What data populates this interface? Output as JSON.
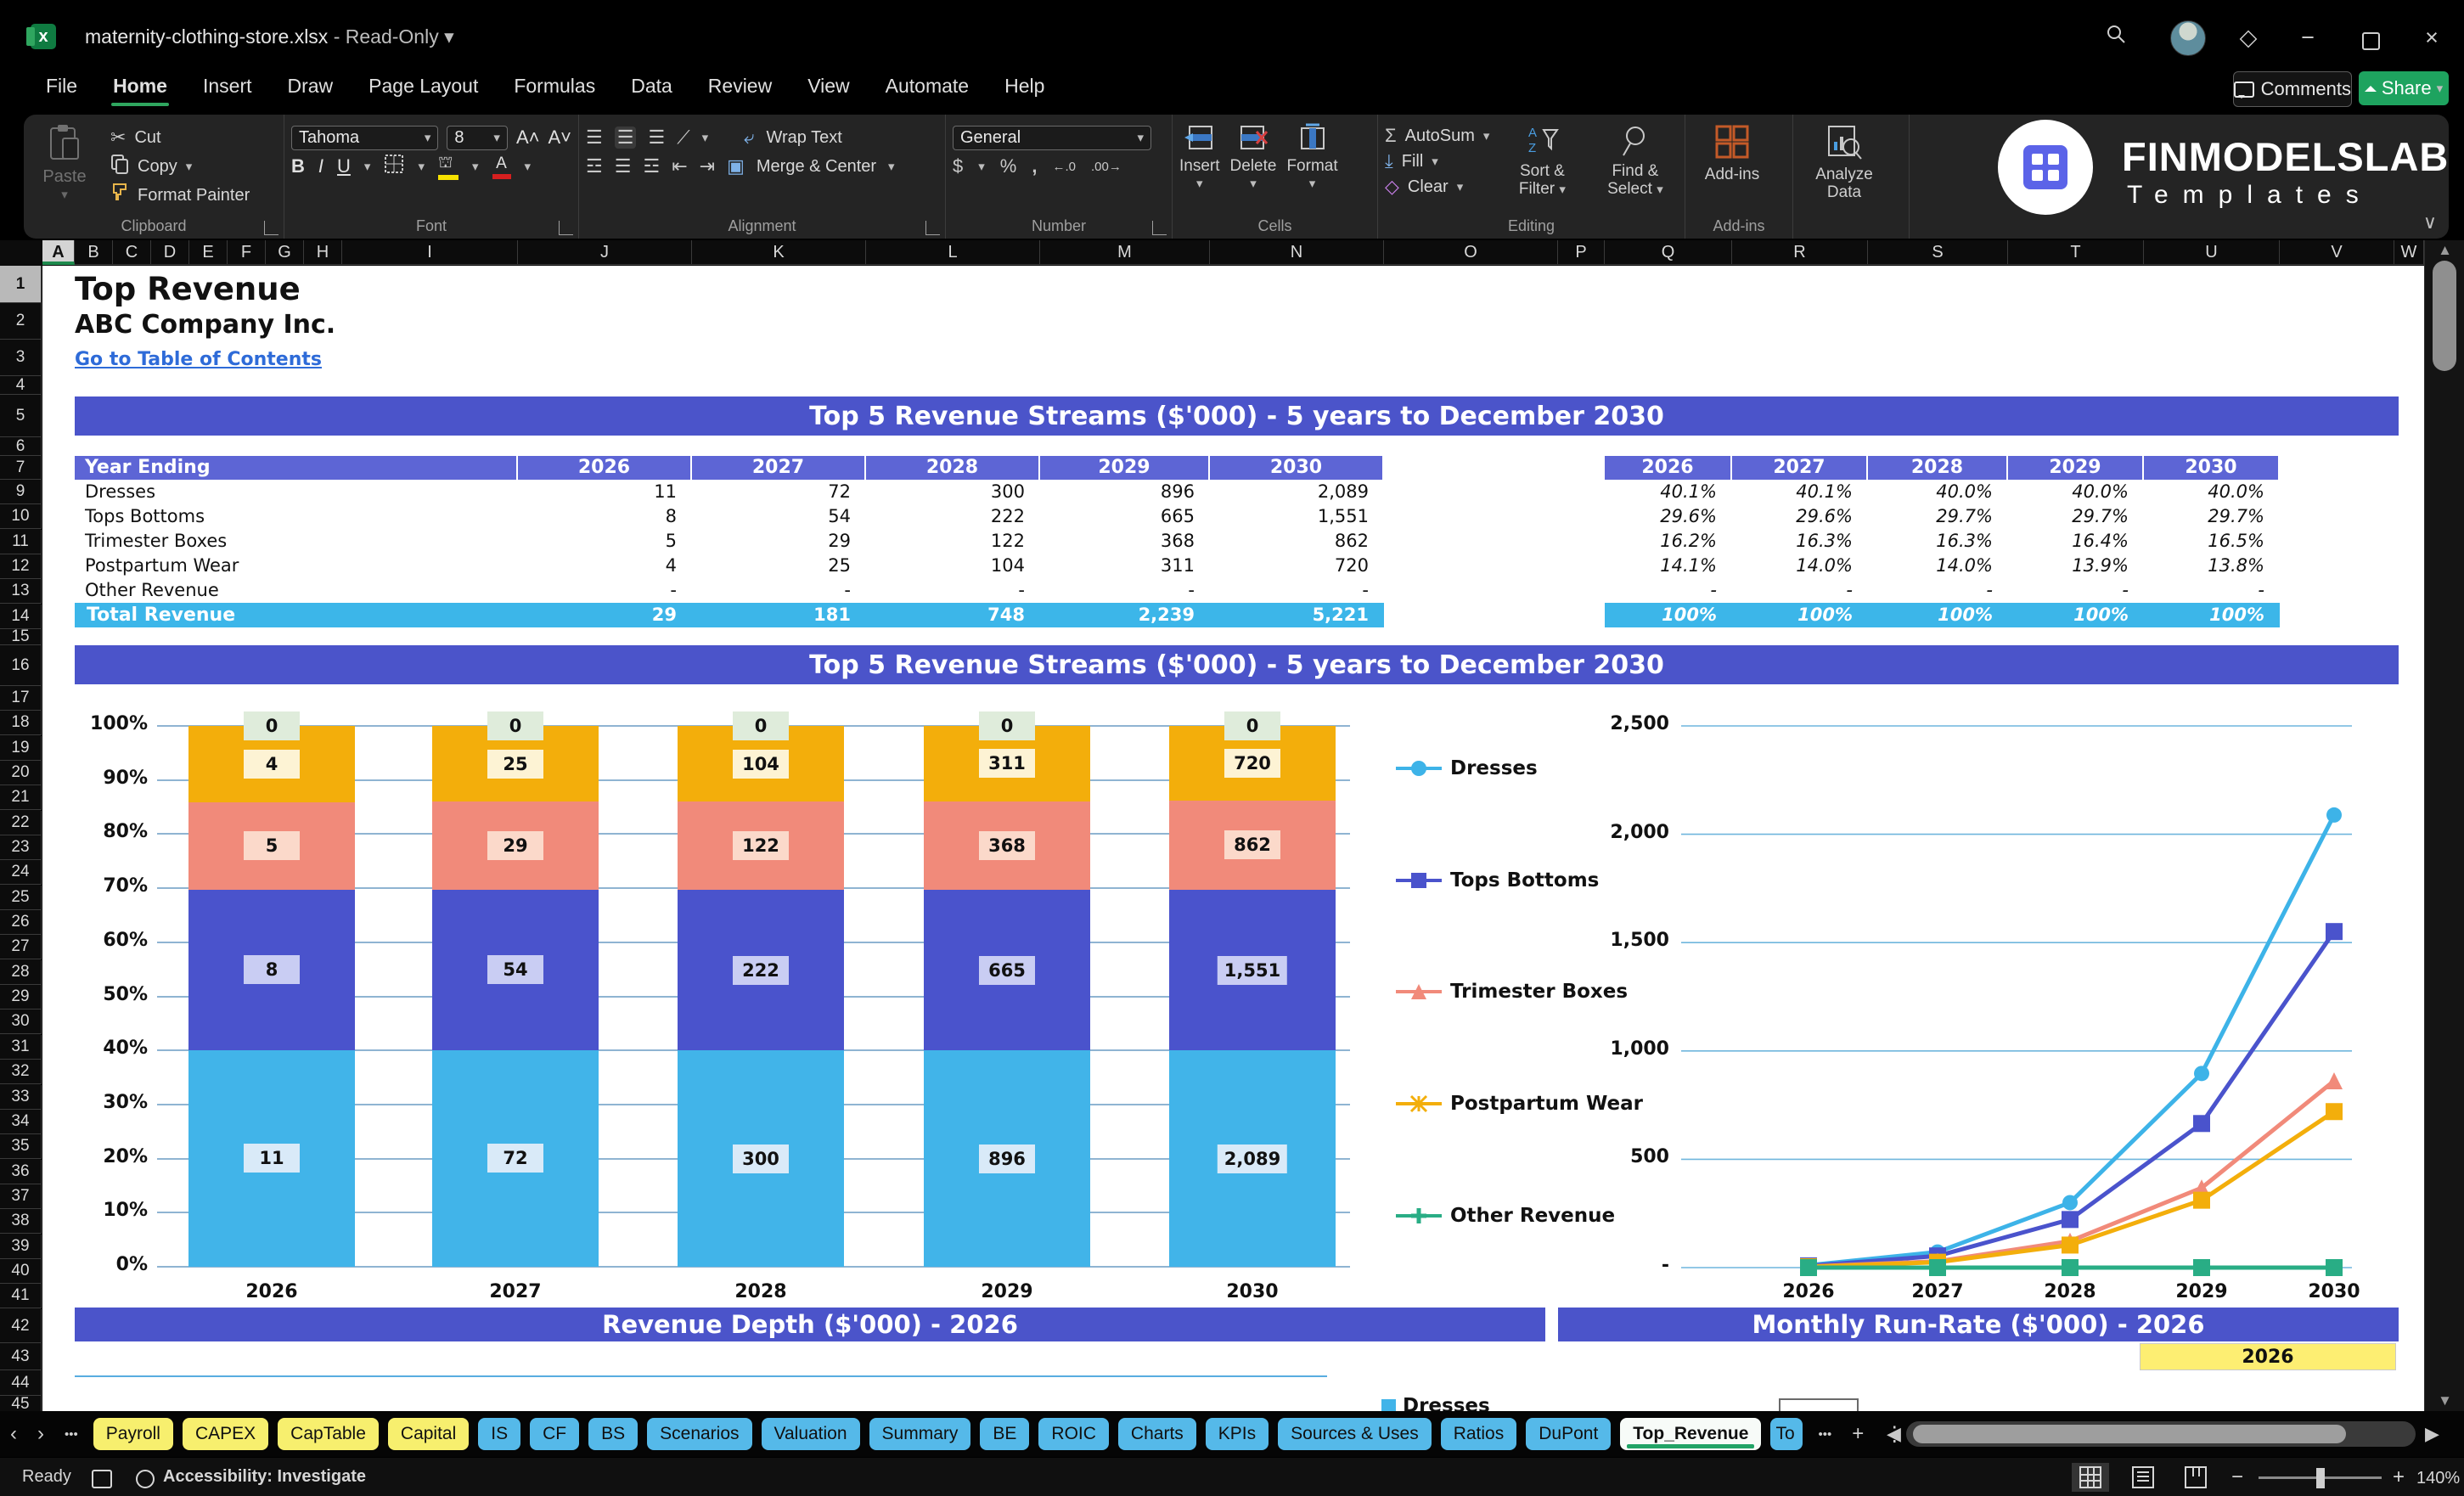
{
  "titlebar": {
    "filename": "maternity-clothing-store.xlsx",
    "separator": "-",
    "mode": "Read-Only"
  },
  "menu": {
    "items": [
      "File",
      "Home",
      "Insert",
      "Draw",
      "Page Layout",
      "Formulas",
      "Data",
      "Review",
      "View",
      "Automate",
      "Help"
    ],
    "active": "Home",
    "comments": "Comments",
    "share": "Share"
  },
  "ribbon": {
    "clipboard": {
      "label": "Clipboard",
      "paste": "Paste",
      "cut": "Cut",
      "copy": "Copy",
      "format_painter": "Format Painter"
    },
    "font": {
      "label": "Font",
      "family": "Tahoma",
      "size": "8"
    },
    "alignment": {
      "label": "Alignment",
      "wrap": "Wrap Text",
      "merge": "Merge & Center"
    },
    "number": {
      "label": "Number",
      "format": "General"
    },
    "cells": {
      "label": "Cells",
      "insert": "Insert",
      "delete": "Delete",
      "format": "Format"
    },
    "editing": {
      "label": "Editing",
      "autosum": "AutoSum",
      "fill": "Fill",
      "clear": "Clear",
      "sort": "Sort & Filter",
      "find": "Find & Select"
    },
    "addins": {
      "label": "Add-ins",
      "button": "Add-ins",
      "analyze_line1": "Analyze",
      "analyze_line2": "Data"
    },
    "brand": {
      "line1": "FINMODELSLAB",
      "line2": "Templates"
    }
  },
  "sheet": {
    "title": "Top Revenue",
    "company": "ABC Company Inc.",
    "link": "Go to Table of Contents",
    "banner_top": "Top 5 Revenue Streams ($'000) - 5 years to December 2030",
    "banner_chart": "Top 5 Revenue Streams ($'000) - 5 years to December 2030",
    "banner_depth": "Revenue Depth ($'000) - 2026",
    "banner_runrate": "Monthly Run-Rate ($'000) - 2026",
    "runrate_year": "2026",
    "columns": [
      "A",
      "B",
      "C",
      "D",
      "E",
      "F",
      "G",
      "H",
      "I",
      "J",
      "K",
      "L",
      "M",
      "N",
      "O",
      "P",
      "Q",
      "R",
      "S",
      "T",
      "U",
      "V",
      "W"
    ],
    "row_numbers": [
      "1",
      "2",
      "3",
      "4",
      "5",
      "6",
      "7",
      "9",
      "10",
      "11",
      "12",
      "13",
      "14",
      "15",
      "16",
      "17",
      "18",
      "19",
      "20",
      "21",
      "22",
      "23",
      "24",
      "25",
      "26",
      "27",
      "28",
      "29",
      "30",
      "31",
      "32",
      "33",
      "34",
      "35",
      "36",
      "37",
      "38",
      "39",
      "40",
      "41",
      "42",
      "43",
      "44",
      "45"
    ],
    "table": {
      "header": "Year Ending",
      "years": [
        "2026",
        "2027",
        "2028",
        "2029",
        "2030"
      ],
      "rows": [
        {
          "name": "Dresses",
          "values": [
            "11",
            "72",
            "300",
            "896",
            "2,089"
          ],
          "pct": [
            "40.1%",
            "40.1%",
            "40.0%",
            "40.0%",
            "40.0%"
          ]
        },
        {
          "name": "Tops Bottoms",
          "values": [
            "8",
            "54",
            "222",
            "665",
            "1,551"
          ],
          "pct": [
            "29.6%",
            "29.6%",
            "29.7%",
            "29.7%",
            "29.7%"
          ]
        },
        {
          "name": "Trimester Boxes",
          "values": [
            "5",
            "29",
            "122",
            "368",
            "862"
          ],
          "pct": [
            "16.2%",
            "16.3%",
            "16.3%",
            "16.4%",
            "16.5%"
          ]
        },
        {
          "name": "Postpartum Wear",
          "values": [
            "4",
            "25",
            "104",
            "311",
            "720"
          ],
          "pct": [
            "14.1%",
            "14.0%",
            "14.0%",
            "13.9%",
            "13.8%"
          ]
        },
        {
          "name": "Other Revenue",
          "values": [
            "-",
            "-",
            "-",
            "-",
            "-"
          ],
          "pct": [
            "-",
            "-",
            "-",
            "-",
            "-"
          ]
        }
      ],
      "total": {
        "name": "Total Revenue",
        "values": [
          "29",
          "181",
          "748",
          "2,239",
          "5,221"
        ],
        "pct": [
          "100%",
          "100%",
          "100%",
          "100%",
          "100%"
        ]
      }
    },
    "monthly_legend": "Dresses"
  },
  "chart_data": [
    {
      "type": "bar",
      "subtype": "stacked-100pct",
      "title": "Top 5 Revenue Streams ($'000) - 5 years to December 2030",
      "categories": [
        "2026",
        "2027",
        "2028",
        "2029",
        "2030"
      ],
      "y_ticks": [
        "100%",
        "90%",
        "80%",
        "70%",
        "60%",
        "50%",
        "40%",
        "30%",
        "20%",
        "10%",
        "0%"
      ],
      "ylim": [
        "0%",
        "100%"
      ],
      "grid": true,
      "series": [
        {
          "name": "Dresses",
          "color": "#41b4e9",
          "label_bg": "#d9eaf8",
          "values": [
            11,
            72,
            300,
            896,
            2089
          ],
          "pct": [
            40.1,
            40.1,
            40.0,
            40.0,
            40.0
          ],
          "labels": [
            "11",
            "72",
            "300",
            "896",
            "2,089"
          ]
        },
        {
          "name": "Tops Bottoms",
          "color": "#4a53cc",
          "label_bg": "#c9cdf3",
          "values": [
            8,
            54,
            222,
            665,
            1551
          ],
          "pct": [
            29.6,
            29.6,
            29.7,
            29.7,
            29.7
          ],
          "labels": [
            "8",
            "54",
            "222",
            "665",
            "1,551"
          ]
        },
        {
          "name": "Trimester Boxes",
          "color": "#f18a7a",
          "label_bg": "#fbd9ca",
          "values": [
            5,
            29,
            122,
            368,
            862
          ],
          "pct": [
            16.2,
            16.3,
            16.3,
            16.4,
            16.5
          ],
          "labels": [
            "5",
            "29",
            "122",
            "368",
            "862"
          ]
        },
        {
          "name": "Postpartum Wear",
          "color": "#f3ae0b",
          "label_bg": "#fdf3d4",
          "values": [
            4,
            25,
            104,
            311,
            720
          ],
          "pct": [
            14.1,
            14.0,
            14.0,
            13.9,
            13.8
          ],
          "labels": [
            "4",
            "25",
            "104",
            "311",
            "720"
          ]
        },
        {
          "name": "Other Revenue",
          "color": "#29ad85",
          "label_bg": "#dfecdb",
          "values": [
            0,
            0,
            0,
            0,
            0
          ],
          "pct": [
            0,
            0,
            0,
            0,
            0
          ],
          "labels": [
            "0",
            "0",
            "0",
            "0",
            "0"
          ]
        }
      ]
    },
    {
      "type": "line",
      "categories": [
        "2026",
        "2027",
        "2028",
        "2029",
        "2030"
      ],
      "y_ticks": [
        "2,500",
        "2,000",
        "1,500",
        "1,000",
        "500",
        "-"
      ],
      "ylim": [
        0,
        2500
      ],
      "grid": true,
      "legend_position": "left",
      "series": [
        {
          "name": "Dresses",
          "color": "#3db3e8",
          "marker": "circle",
          "legend_marker": "circle",
          "values": [
            11,
            72,
            300,
            896,
            2089
          ]
        },
        {
          "name": "Tops Bottoms",
          "color": "#4a53cc",
          "marker": "square",
          "legend_marker": "square",
          "values": [
            8,
            54,
            222,
            665,
            1551
          ]
        },
        {
          "name": "Trimester Boxes",
          "color": "#f18a7a",
          "marker": "triangle",
          "legend_marker": "triangle",
          "values": [
            5,
            29,
            122,
            368,
            862
          ]
        },
        {
          "name": "Postpartum Wear",
          "color": "#f3ae0b",
          "marker": "square",
          "legend_marker": "xstar",
          "values": [
            4,
            25,
            104,
            311,
            720
          ]
        },
        {
          "name": "Other Revenue",
          "color": "#29ad85",
          "marker": "square",
          "legend_marker": "plus",
          "values": [
            0,
            0,
            0,
            0,
            0
          ]
        }
      ]
    }
  ],
  "tabs": {
    "sheets": [
      {
        "label": "Payroll",
        "color": "yellow"
      },
      {
        "label": "CAPEX",
        "color": "yellow"
      },
      {
        "label": "CapTable",
        "color": "yellow"
      },
      {
        "label": "Capital",
        "color": "yellow"
      },
      {
        "label": "IS",
        "color": "blue"
      },
      {
        "label": "CF",
        "color": "blue"
      },
      {
        "label": "BS",
        "color": "blue"
      },
      {
        "label": "Scenarios",
        "color": "blue"
      },
      {
        "label": "Valuation",
        "color": "blue"
      },
      {
        "label": "Summary",
        "color": "blue"
      },
      {
        "label": "BE",
        "color": "blue"
      },
      {
        "label": "ROIC",
        "color": "blue"
      },
      {
        "label": "Charts",
        "color": "blue"
      },
      {
        "label": "KPIs",
        "color": "blue"
      },
      {
        "label": "Sources & Uses",
        "color": "blue"
      },
      {
        "label": "Ratios",
        "color": "blue"
      },
      {
        "label": "DuPont",
        "color": "blue"
      },
      {
        "label": "Top_Revenue",
        "color": "active"
      },
      {
        "label": "To",
        "color": "blue partial"
      }
    ]
  },
  "status": {
    "ready": "Ready",
    "accessibility": "Accessibility: Investigate",
    "zoom": "140%"
  },
  "icons": {
    "nav_prev": "‹",
    "nav_next": "›",
    "tab_overflow": "•••",
    "more_tabs": "•••",
    "add_sheet": "+",
    "tab_menu": "⋮",
    "hscroll_left": "◀",
    "hscroll_right": "▶",
    "vscroll_up": "▲",
    "vscroll_down": "▼",
    "minimize": "−",
    "close": "×",
    "diamond": "◇",
    "dropdown": "▾",
    "collapse": "∨",
    "sigma": "Σ",
    "scissors": "✂",
    "dollar": "$",
    "percent": "%",
    "comma": ",",
    "dec_inc": "←.0",
    "dec_dec": ".00→",
    "bold": "B",
    "italic": "I",
    "underline": "U",
    "font_bigger": "A˄",
    "font_smaller": "A˅"
  },
  "colors": {
    "accent_green": "#21a366",
    "banner_purple": "#4b54ca",
    "table_header_purple": "#5d65d5",
    "total_row_cyan": "#3cb6e9",
    "link_blue": "#2e6bd8",
    "tab_yellow": "#f7ef6e",
    "tab_blue": "#55b9e9",
    "yellow_cell": "#fdee72"
  }
}
